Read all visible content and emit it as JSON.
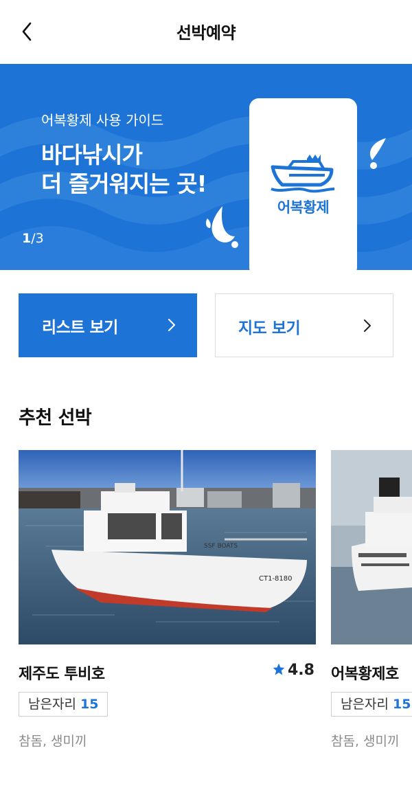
{
  "header": {
    "title": "선박예약"
  },
  "banner": {
    "subtitle": "어복황제 사용 가이드",
    "headline": "바다낚시가\n더 즐거워지는 곳!",
    "page_current": "1",
    "page_total": "/3",
    "brand": "어복황제",
    "colors": {
      "background": "#1e74d6",
      "wave": "#3c8ce0"
    }
  },
  "actions": {
    "list_label": "리스트 보기",
    "map_label": "지도 보기",
    "accent": "#1e74d6"
  },
  "recommended": {
    "title": "추천 선박",
    "cards": [
      {
        "name": "제주도 투비호",
        "rating": "4.8",
        "seats_label": "남은자리",
        "seats": "15",
        "tags": "참돔, 생미끼"
      },
      {
        "name": "어복황제호",
        "rating": "",
        "seats_label": "남은자리",
        "seats": "15",
        "tags": "참돔, 생미끼"
      }
    ]
  },
  "icons": [
    "back-arrow-icon",
    "chevron-right-icon",
    "star-icon",
    "ship-crown-logo-icon",
    "water-splash-icon"
  ]
}
